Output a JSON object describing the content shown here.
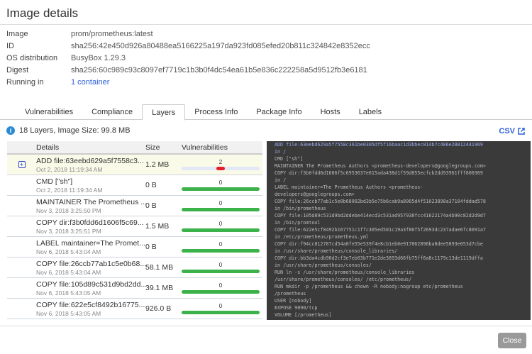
{
  "title": "Image details",
  "info": [
    {
      "label": "Image",
      "value": "prom/prometheus:latest"
    },
    {
      "label": "ID",
      "value": "sha256:42e450d926a80488ea5166225a197da923fd085efed20b811c324842e8352ecc"
    },
    {
      "label": "OS distribution",
      "value": "BusyBox 1.29.3"
    },
    {
      "label": "Digest",
      "value": "sha256:60c989c93c8097ef7719c1b3b0f4dc54ea61b5e836c222258a5d9512fb3e6181"
    },
    {
      "label": "Running in",
      "value": "1 container"
    }
  ],
  "tabs": [
    "Vulnerabilities",
    "Compliance",
    "Layers",
    "Process Info",
    "Package Info",
    "Hosts",
    "Labels"
  ],
  "active_tab": "Layers",
  "summary": "18 Layers, Image Size: 99.8 MB",
  "csv_label": "CSV",
  "columns": [
    "Details",
    "Size",
    "Vulnerabilities"
  ],
  "rows": [
    {
      "detail": "ADD file:63eebd629a5f7558c3...",
      "date": "Oct 2, 2018 11:19:34 AM",
      "size": "1.2 MB",
      "vulns": "2",
      "selected": true
    },
    {
      "detail": "CMD [\"sh\"]",
      "date": "Oct 2, 2018 11:19:34 AM",
      "size": "0 B",
      "vulns": "0"
    },
    {
      "detail": "MAINTAINER The Prometheus ...",
      "date": "Nov 3, 2018 3:25:50 PM",
      "size": "0 B",
      "vulns": "0"
    },
    {
      "detail": "COPY dir:f3b0fdd6d1606f5c69...",
      "date": "Nov 3, 2018 3:25:51 PM",
      "size": "1.5 MB",
      "vulns": "0"
    },
    {
      "detail": "LABEL maintainer=The Promet...",
      "date": "Nov 6, 2018 5:43:04 AM",
      "size": "0 B",
      "vulns": "0"
    },
    {
      "detail": "COPY file:26ccb77ab1c5e0b68...",
      "date": "Nov 6, 2018 5:43:04 AM",
      "size": "58.1 MB",
      "vulns": "0"
    },
    {
      "detail": "COPY file:105d89c531d9bd2dd...",
      "date": "Nov 6, 2018 5:43:05 AM",
      "size": "39.1 MB",
      "vulns": "0"
    },
    {
      "detail": "COPY file:622e5cf8492b16775...",
      "date": "Nov 6, 2018 5:43:05 AM",
      "size": "926.0 B",
      "vulns": "0"
    }
  ],
  "code_highlight": "ADD file:63eebd629a5f7558c361be0305df5f16baac1d3bbec014b7c486e28812441969\nin /",
  "code": "CMD [\"sh\"]\nMAINTAINER The Prometheus Authors <prometheus-developers@googlegroups.com>\nCOPY dir:f3b0fdd6d1606f5c6953637e615ada438d1f59d855ecfcb2dd93961fff806969\nin /\nLABEL maintainer=The Prometheus Authors <prometheus-\ndevelopers@googlegroups.com>\nCOPY file:26ccb77ab1c5e0b68002bd3b5e75b6cab9a8065d4f51023898a37104fddad578\nin /bin/prometheus\nCOPY file:105d89c531d9bd2ddebe414ecd3c531ad957938fcc41622174a4b90c82d2d9d7\nin /bin/promtool\nCOPY file:622e5cf8492b167751c1ffc305ed501c19a3f86f5f2693dc237adae6fc8091a7\nin /etc/prometheus/prometheus.yml\nCOPY dir:f94cc812707cd54a0fe55e539f4e8cb1eb0e917862896ba8dee5893e053d7cbe\nin /usr/share/prometheus/console_libraries/\nCOPY dir:bb3da4cdb90d2cf3e7eb03b771e2de3893d66fb75ff6a8c1179c13de1119dffa\nin /usr/share/prometheus/consoles/\nRUN ln -s /usr/share/prometheus/console_libraries\n/usr/share/prometheus/consoles/ /etc/prometheus/\nRUN mkdir -p /prometheus && chown -R nobody:nogroup etc/prometheus\n/prometheus\nUSER [nobody]\nEXPOSE 9090/tcp\nVOLUME [/prometheus]",
  "close_label": "Close",
  "colors": {
    "accent": "#2b5fd9",
    "ok": "#3cb24a",
    "critical": "#e21f26"
  }
}
